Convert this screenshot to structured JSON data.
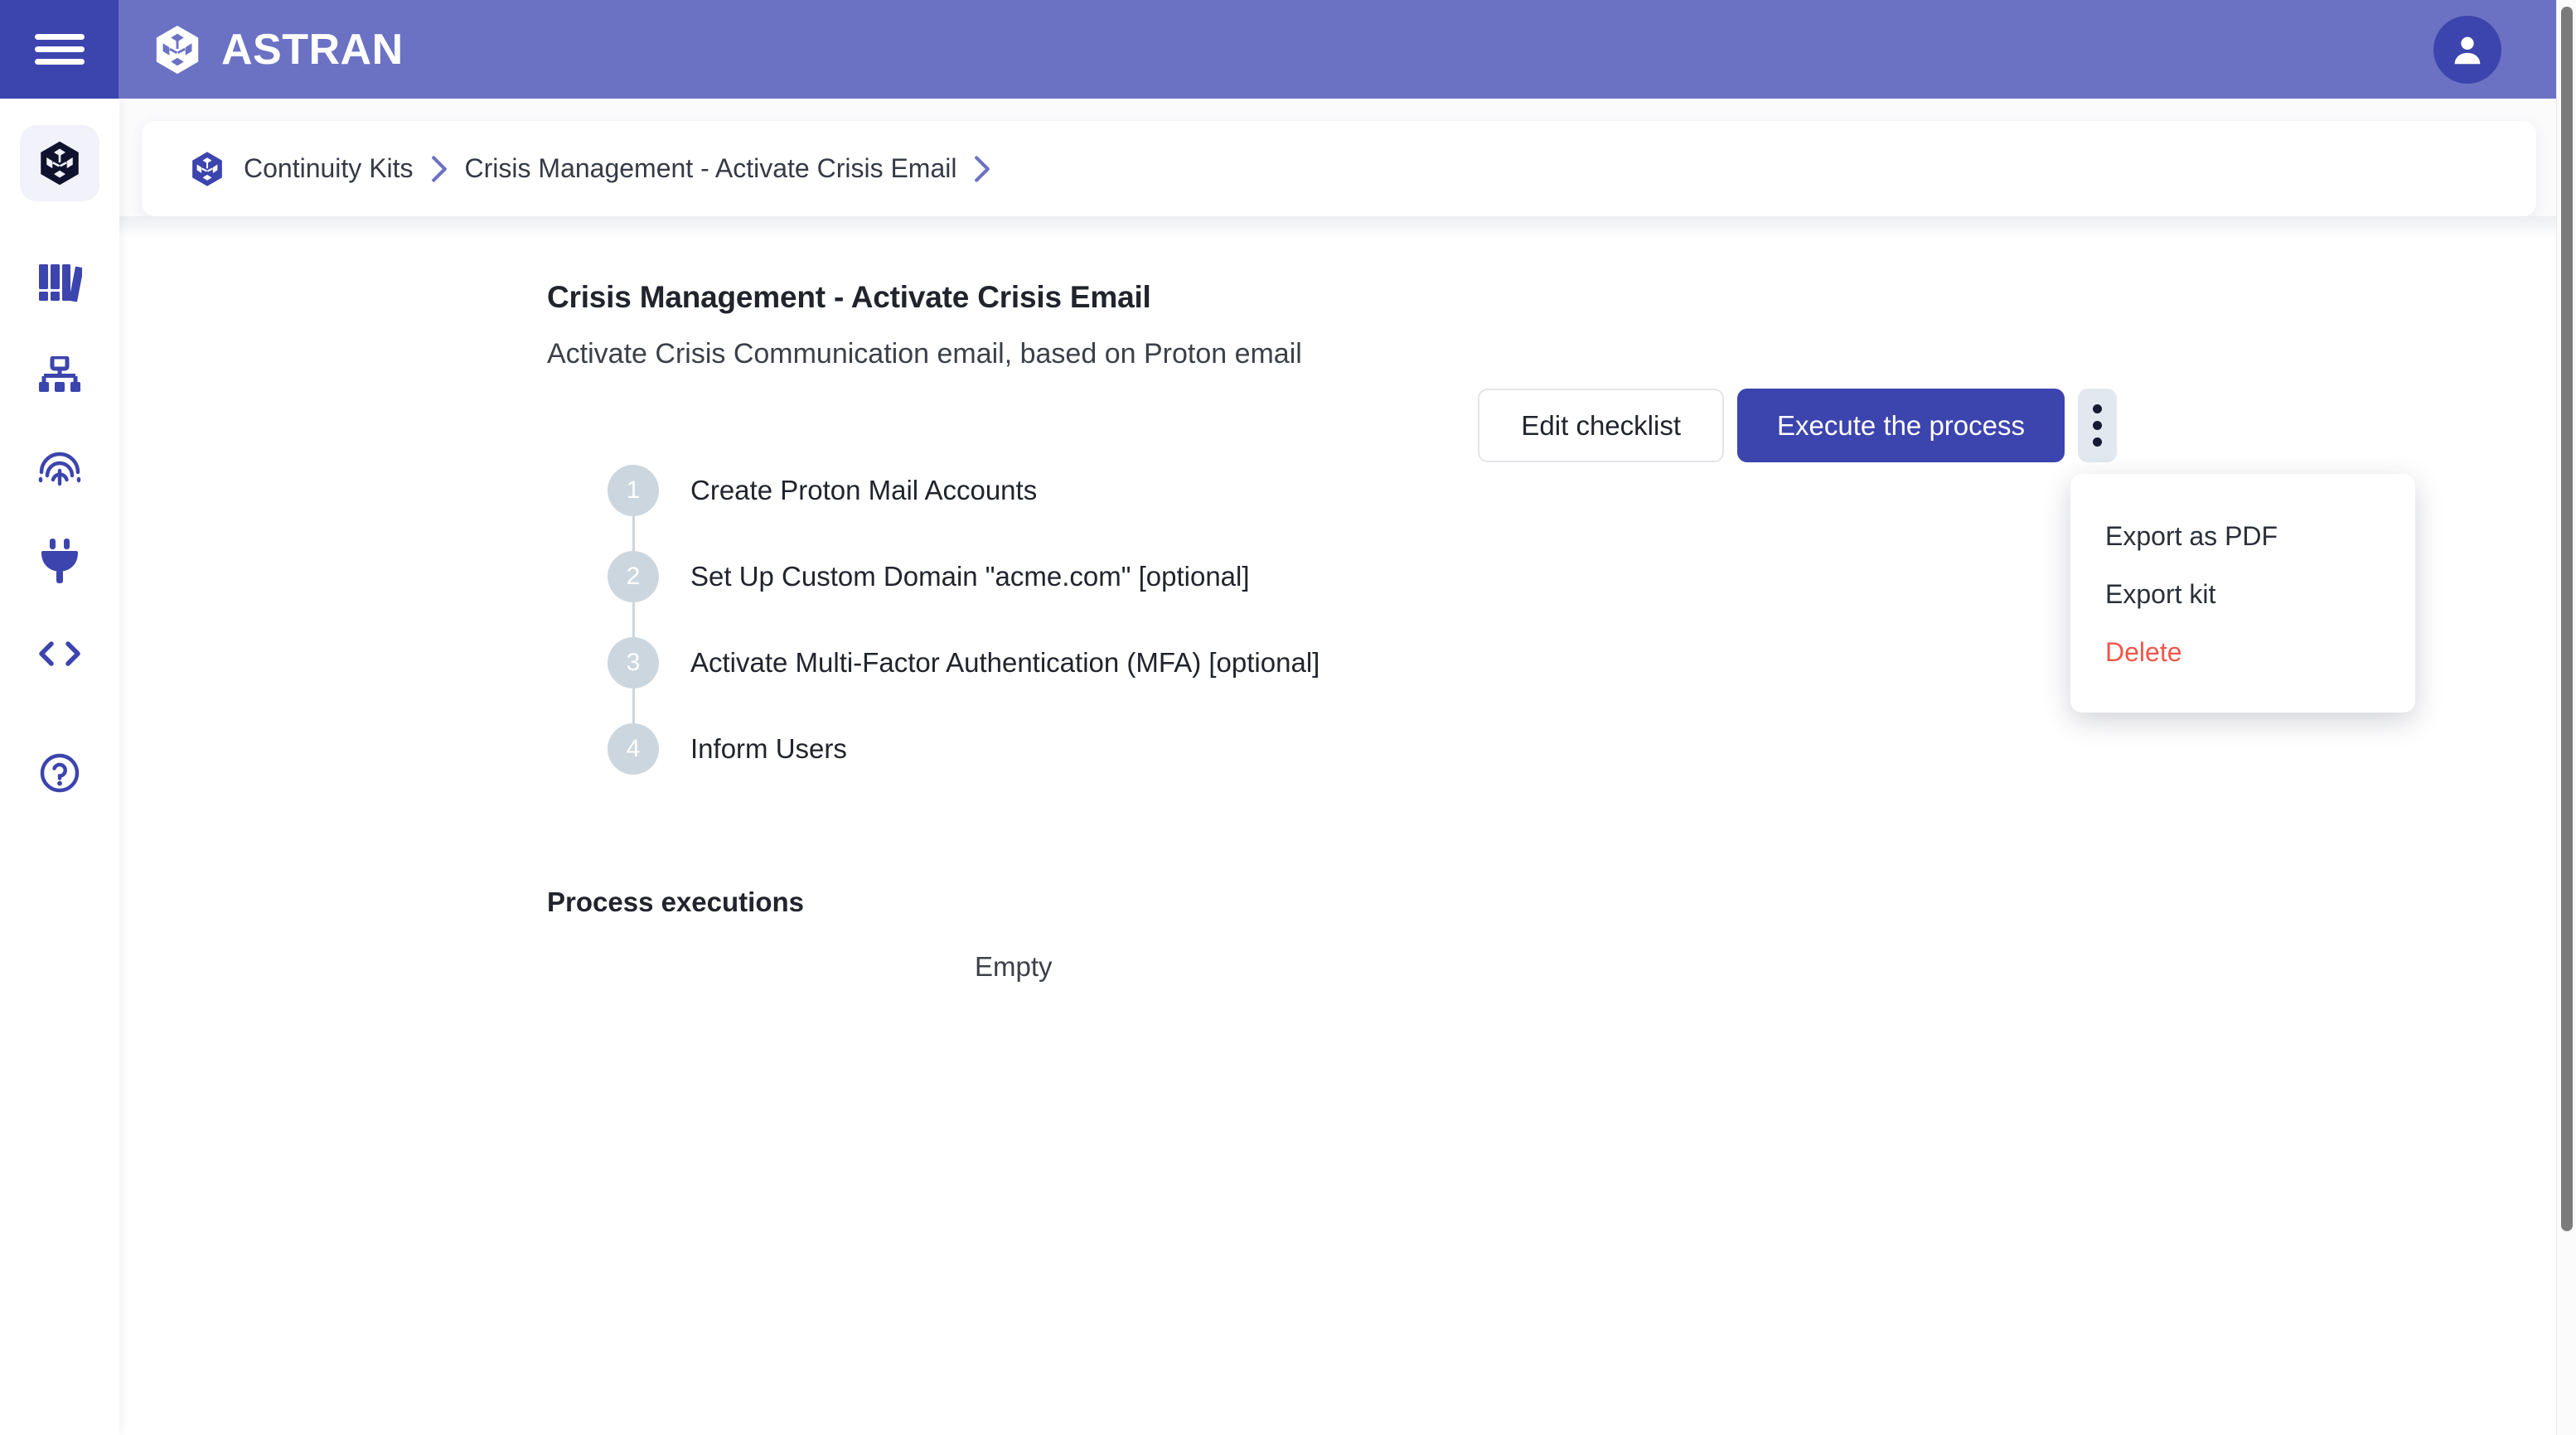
{
  "brand": {
    "name": "ASTRAN",
    "logo_icon": "astran-hexagon-logo",
    "menu_icon": "hamburger-menu-icon",
    "avatar_icon": "user-avatar-icon"
  },
  "sidebar": {
    "items": [
      {
        "icon": "hexagon-cube-icon",
        "name": "continuity-kits",
        "active": true
      },
      {
        "icon": "books-library-icon",
        "name": "library",
        "active": false
      },
      {
        "icon": "sitemap-icon",
        "name": "org-chart",
        "active": false
      },
      {
        "icon": "fingerprint-icon",
        "name": "identity",
        "active": false
      },
      {
        "icon": "plug-icon",
        "name": "integrations",
        "active": false
      },
      {
        "icon": "code-brackets-icon",
        "name": "developers",
        "active": false
      },
      {
        "icon": "help-circle-icon",
        "name": "help",
        "active": false
      }
    ]
  },
  "breadcrumb": {
    "logo_icon": "astran-mark-icon",
    "root": "Continuity Kits",
    "current": "Crisis Management - Activate Crisis Email",
    "separator_icon": "chevron-right-icon"
  },
  "page": {
    "title": "Crisis Management - Activate Crisis Email",
    "subtitle": "Activate Crisis Communication email, based on Proton email"
  },
  "toolbar": {
    "edit_checklist_label": "Edit checklist",
    "execute_label": "Execute the process",
    "kebab_icon": "more-vertical-icon"
  },
  "menu": {
    "items": [
      {
        "label": "Export as PDF",
        "danger": false
      },
      {
        "label": "Export kit",
        "danger": false
      },
      {
        "label": "Delete",
        "danger": true
      }
    ]
  },
  "checklist": {
    "steps": [
      {
        "number": "1",
        "label": "Create Proton Mail Accounts"
      },
      {
        "number": "2",
        "label": "Set Up Custom Domain \"acme.com\" [optional]"
      },
      {
        "number": "3",
        "label": "Activate Multi-Factor Authentication (MFA) [optional]"
      },
      {
        "number": "4",
        "label": "Inform Users"
      }
    ]
  },
  "executions": {
    "heading": "Process executions",
    "empty_label": "Empty"
  },
  "colors": {
    "header": "#6b72c4",
    "header_dark": "#3c44ad",
    "primary": "#3c44ad",
    "danger": "#f0564a",
    "step_bullet": "#ccd6de"
  }
}
